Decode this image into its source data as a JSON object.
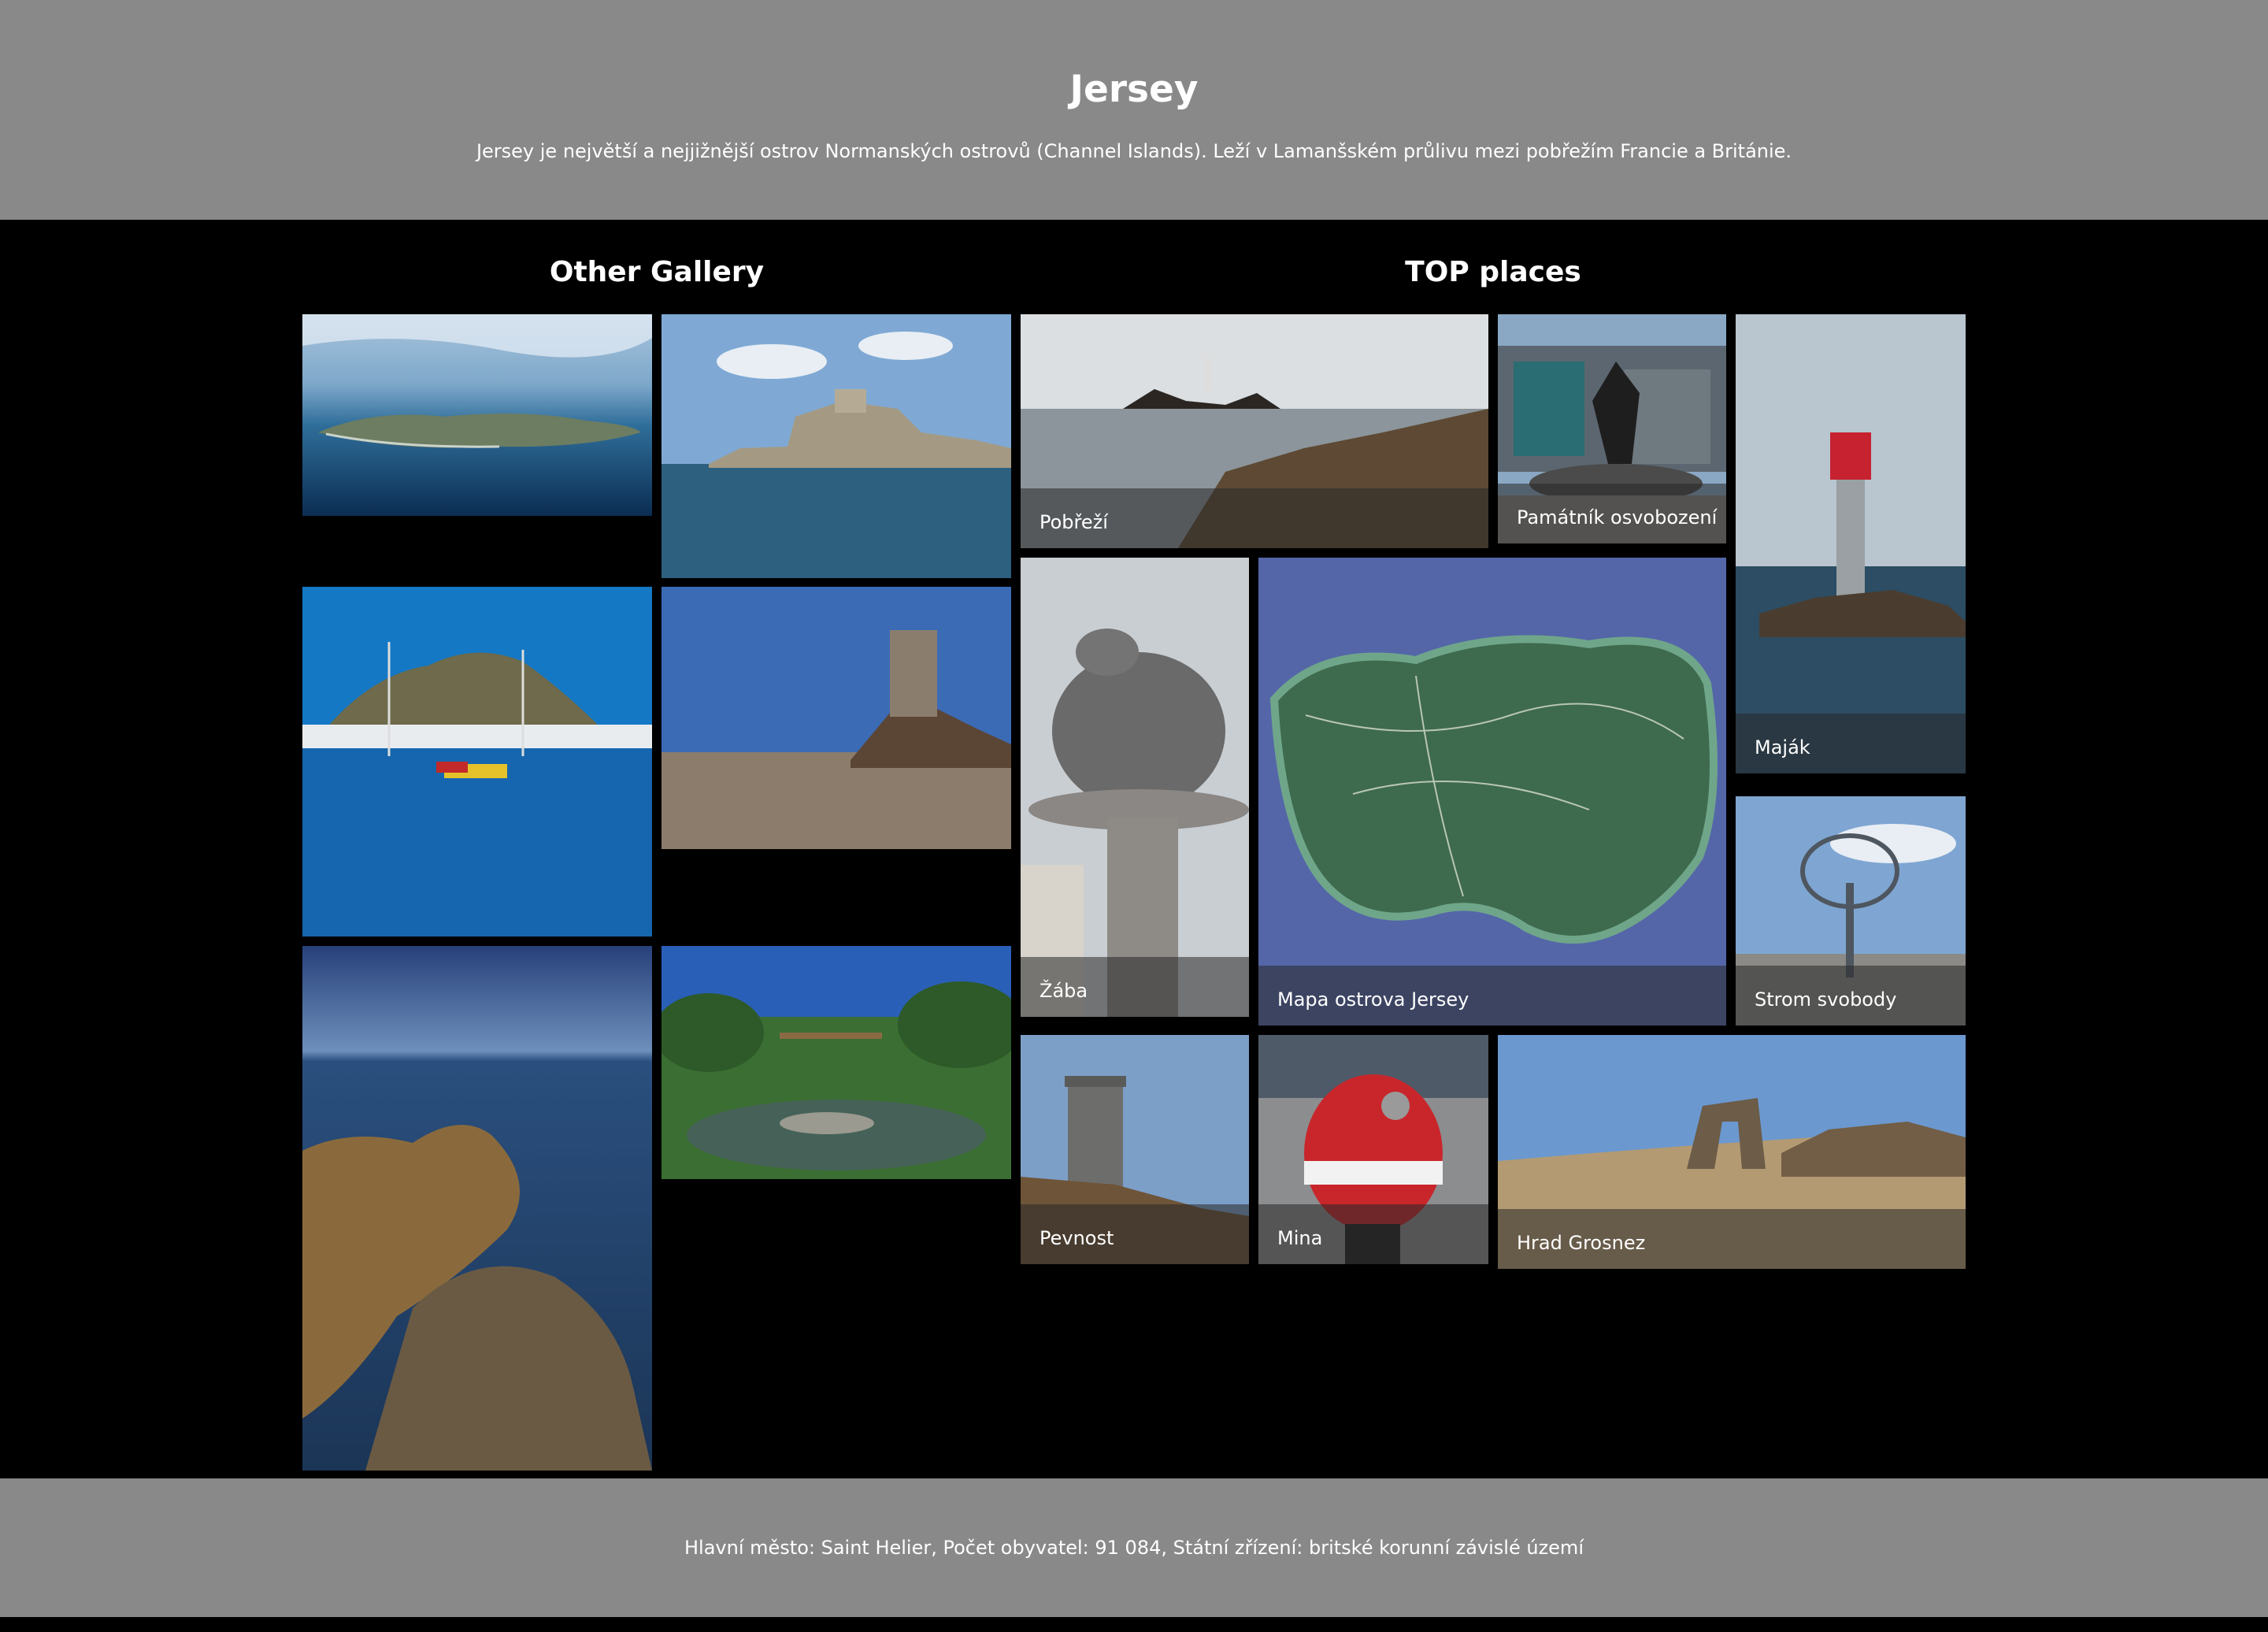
{
  "header": {
    "title": "Jersey",
    "description": "Jersey je největší a nejjižnější ostrov Normanských ostrovů (Channel Islands). Leží v Lamanšském průlivu mezi pobřežím Francie a Británie."
  },
  "gallery": {
    "title": "Other Gallery",
    "images": [
      {
        "name": "gallery-image-aerial-island"
      },
      {
        "name": "gallery-image-castle-sea"
      },
      {
        "name": "gallery-image-harbour-castle"
      },
      {
        "name": "gallery-image-tower-beach"
      },
      {
        "name": "gallery-image-coastal-cliffs"
      },
      {
        "name": "gallery-image-garden-fountain"
      }
    ]
  },
  "top_places": {
    "title": "TOP places",
    "items": [
      {
        "label": "Pobřeží"
      },
      {
        "label": "Památník osvobození"
      },
      {
        "label": "Maják"
      },
      {
        "label": "Žába"
      },
      {
        "label": "Mapa ostrova Jersey"
      },
      {
        "label": "Strom svobody"
      },
      {
        "label": "Pevnost"
      },
      {
        "label": "Mina"
      },
      {
        "label": "Hrad Grosnez"
      }
    ]
  },
  "footer": {
    "text": "Hlavní město: Saint Helier, Počet obyvatel: 91 084, Státní zřízení: britské korunní závislé území"
  }
}
